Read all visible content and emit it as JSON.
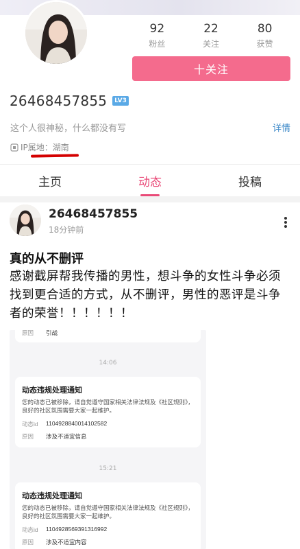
{
  "profile": {
    "stats": [
      {
        "value": "92",
        "label": "粉丝"
      },
      {
        "value": "22",
        "label": "关注"
      },
      {
        "value": "80",
        "label": "获赞"
      }
    ],
    "follow_label": "十关注",
    "uid": "26468457855",
    "level": "LV3",
    "bio": "这个人很神秘，什么都没有写",
    "detail_link": "详情",
    "ip_location": "IP属地：湖南"
  },
  "tabs": [
    {
      "label": "主页"
    },
    {
      "label": "动态"
    },
    {
      "label": "投稿"
    }
  ],
  "active_tab": "动态",
  "post": {
    "username": "26468457855",
    "time": "18分钟前",
    "title": "真的从不删评",
    "body": "感谢截屏帮我传播的男性，想斗争的女性斗争必须找到更合适的方式，从不删评，男性的恶评是斗争者的荣誉！！！！！！"
  },
  "screenshot": {
    "top_row": {
      "key": "原因",
      "value": "引战"
    },
    "notices": [
      {
        "time": "14:06",
        "title": "动态违规处理通知",
        "desc": "您的动态已被移除，请自觉遵守国家相关法律法规及《社区规则》，良好的社区氛围需要大家一起维护。",
        "id_key": "动态id",
        "id_value": "1104928840014102582",
        "reason_key": "原因",
        "reason_value": "涉及不适宜信息"
      },
      {
        "time": "15:21",
        "title": "动态违规处理通知",
        "desc": "您的动态已被移除，请自觉遵守国家相关法律法规及《社区规则》，良好的社区氛围需要大家一起维护。",
        "id_key": "动态id",
        "id_value": "1104928569391316992",
        "reason_key": "原因",
        "reason_value": "涉及不适宜内容"
      }
    ]
  },
  "colors": {
    "accent": "#f46b8d",
    "active_tab": "#e94a78",
    "link": "#3b88c8",
    "underline": "#d40000"
  }
}
